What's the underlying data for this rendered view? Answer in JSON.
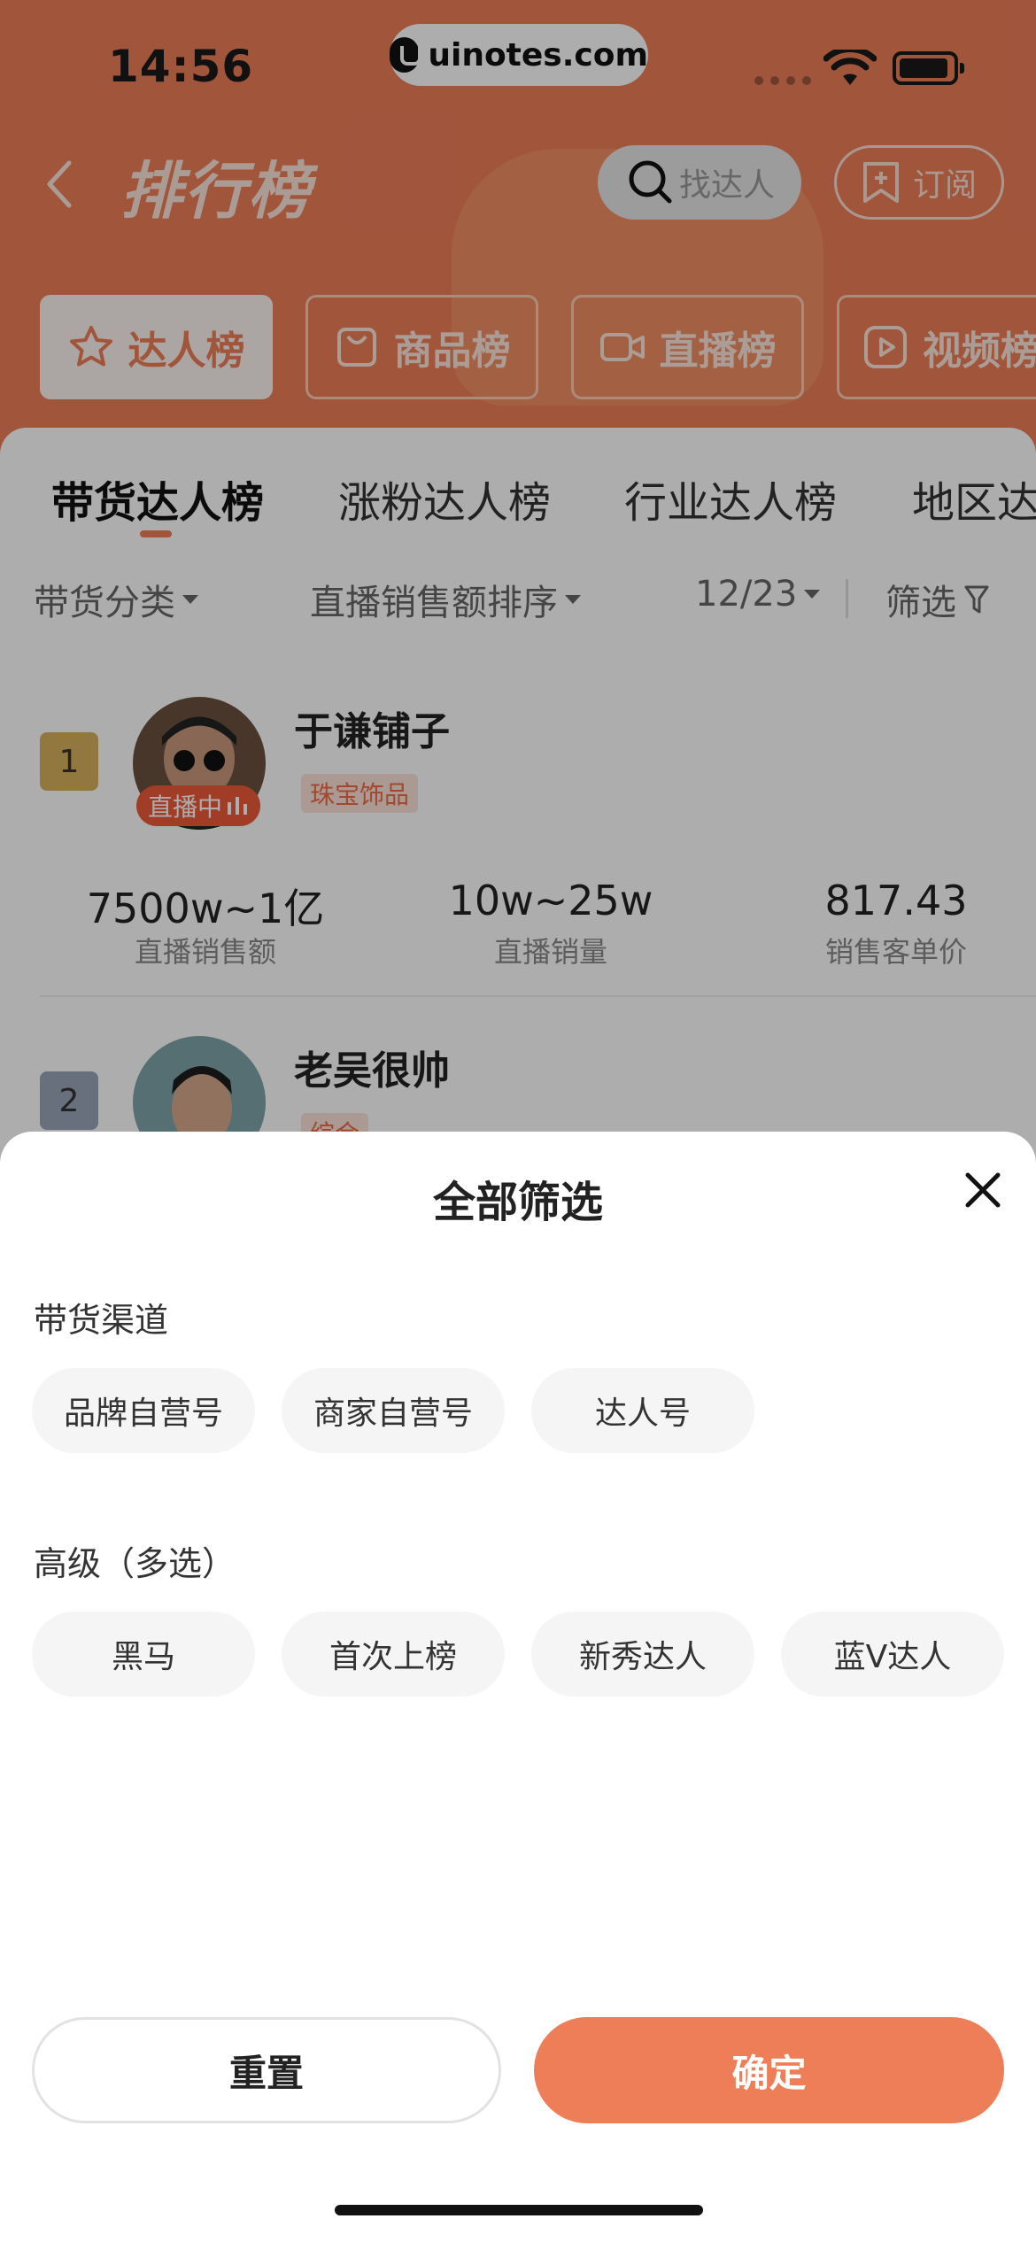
{
  "status_bar": {
    "time": "14:56",
    "watermark": "uinotes.com"
  },
  "header": {
    "title": "排行榜",
    "search_placeholder": "找达人",
    "subscribe_label": "订阅"
  },
  "main_tabs": [
    {
      "label": "达人榜",
      "icon": "star-icon",
      "active": true
    },
    {
      "label": "商品榜",
      "icon": "bag-icon",
      "active": false
    },
    {
      "label": "直播榜",
      "icon": "video-camera-icon",
      "active": false
    },
    {
      "label": "视频榜",
      "icon": "play-icon",
      "active": false
    }
  ],
  "sub_tabs": [
    {
      "label": "带货达人榜",
      "active": true
    },
    {
      "label": "涨粉达人榜",
      "active": false
    },
    {
      "label": "行业达人榜",
      "active": false
    },
    {
      "label": "地区达",
      "active": false
    }
  ],
  "filters": {
    "category": "带货分类",
    "sort": "直播销售额排序",
    "date": "12/23",
    "filter": "筛选"
  },
  "list": [
    {
      "rank": "1",
      "name": "于谦铺子",
      "tag": "珠宝饰品",
      "live_label": "直播中",
      "stats": [
        {
          "value": "7500w~1亿",
          "label": "直播销售额"
        },
        {
          "value": "10w~25w",
          "label": "直播销量"
        },
        {
          "value": "817.43",
          "label": "销售客单价"
        }
      ]
    },
    {
      "rank": "2",
      "name": "老吴很帅",
      "tag": "综合"
    }
  ],
  "sheet": {
    "title": "全部筛选",
    "sections": [
      {
        "title": "带货渠道",
        "options": [
          "品牌自营号",
          "商家自营号",
          "达人号"
        ]
      },
      {
        "title": "高级（多选）",
        "options": [
          "黑马",
          "首次上榜",
          "新秀达人",
          "蓝V达人"
        ]
      }
    ],
    "reset_label": "重置",
    "confirm_label": "确定"
  },
  "colors": {
    "accent": "#ee7e58",
    "live": "#ee5a3a",
    "rank1": "#d8b25c",
    "rank2": "#9aa4b8"
  }
}
